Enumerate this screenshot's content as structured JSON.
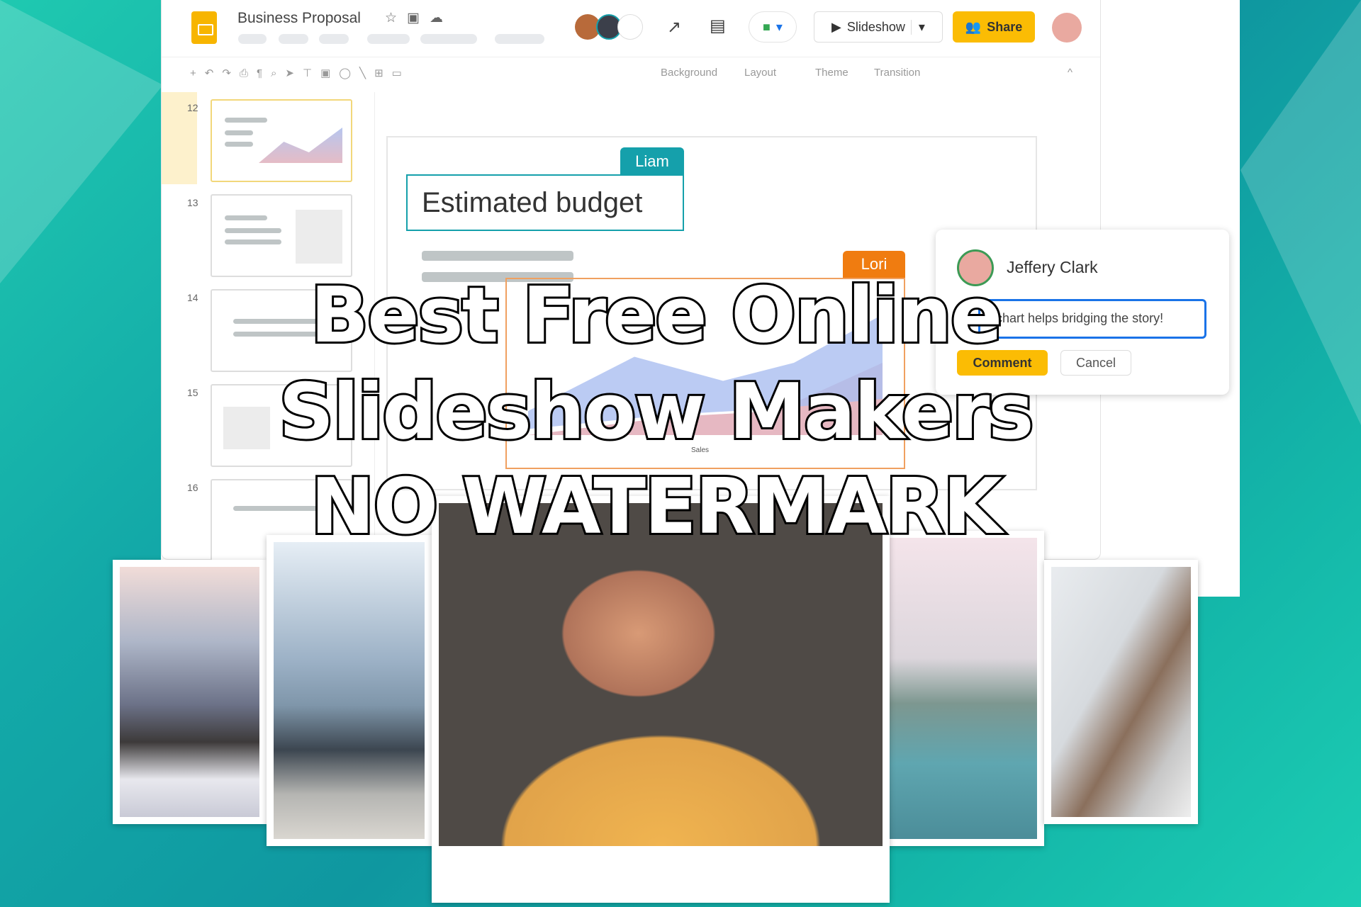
{
  "app": {
    "title": "Business Proposal",
    "slideshow_label": "Slideshow",
    "share_label": "Share"
  },
  "toolbar": {
    "background": "Background",
    "layout": "Layout",
    "theme": "Theme",
    "transition": "Transition"
  },
  "filmstrip": {
    "slides": [
      "12",
      "13",
      "14",
      "15",
      "16"
    ],
    "selected": "12"
  },
  "slide": {
    "title": "Estimated budget",
    "collaborators": [
      {
        "name": "Liam",
        "color": "#15a0ab"
      },
      {
        "name": "Lori",
        "color": "#f07c10"
      }
    ],
    "chart_label": "Sales"
  },
  "comment": {
    "author": "Jeffery Clark",
    "text": "s chart helps bridging the story!",
    "comment_label": "Comment",
    "cancel_label": "Cancel"
  },
  "headline": {
    "line1": "Best Free Online",
    "line2": "Slideshow Makers",
    "line3": "NO WATERMARK"
  },
  "colors": {
    "accent": "#fbbc04",
    "teal": "#15a0ab",
    "orange": "#f07c10"
  }
}
